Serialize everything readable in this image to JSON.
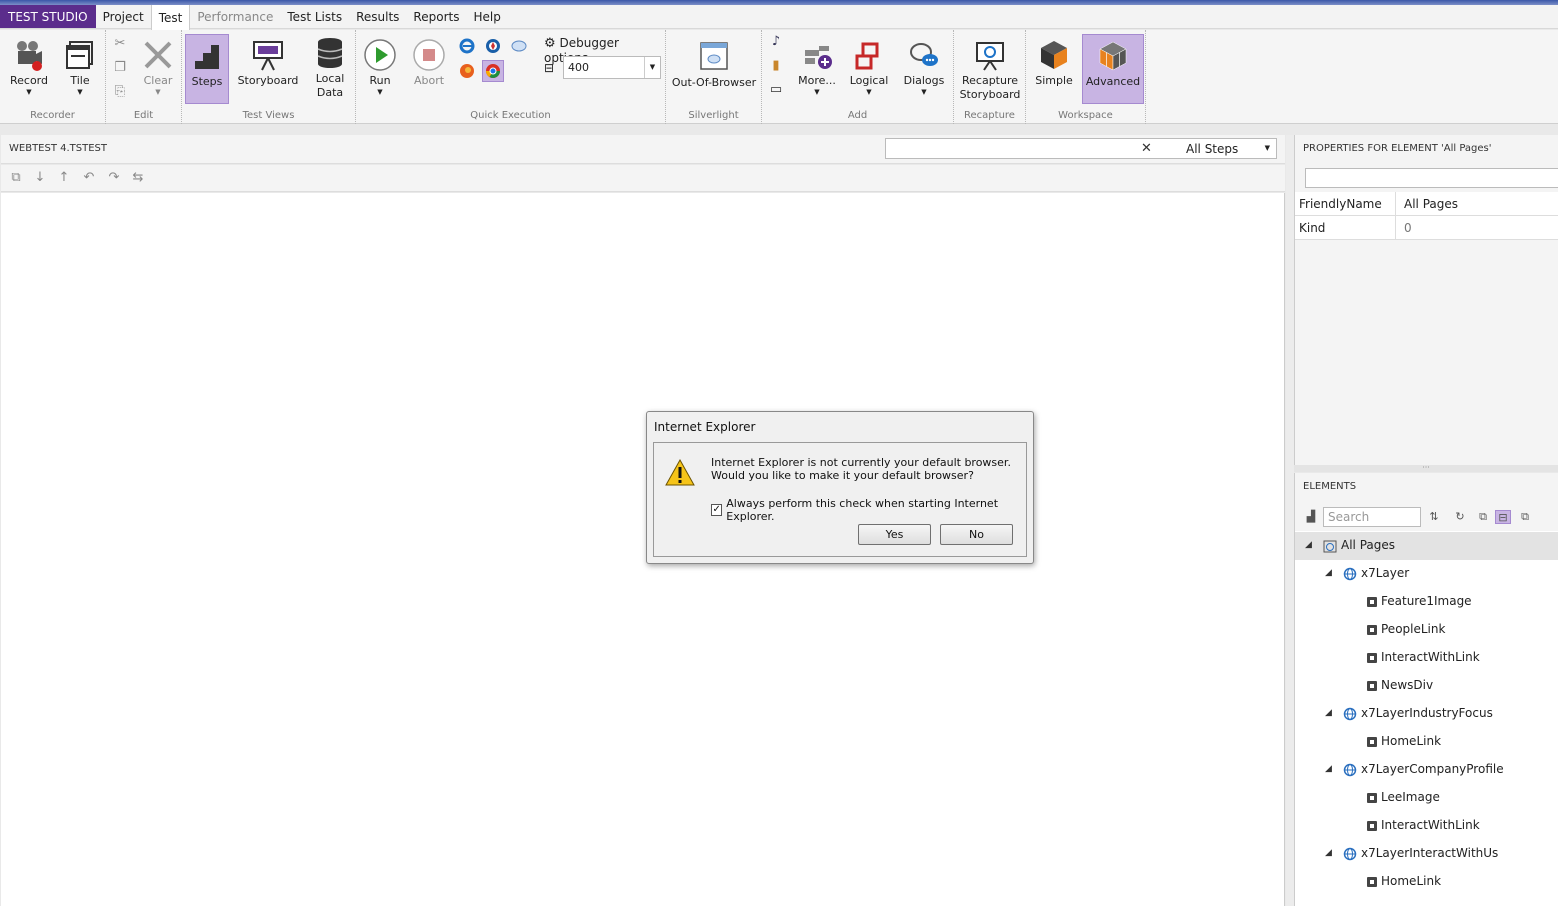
{
  "menubar": {
    "brand": "TEST STUDIO",
    "items": [
      {
        "label": "Project",
        "state": "normal"
      },
      {
        "label": "Test",
        "state": "active"
      },
      {
        "label": "Performance",
        "state": "disabled"
      },
      {
        "label": "Test Lists",
        "state": "normal"
      },
      {
        "label": "Results",
        "state": "normal"
      },
      {
        "label": "Reports",
        "state": "normal"
      },
      {
        "label": "Help",
        "state": "normal"
      }
    ]
  },
  "ribbon": {
    "groups": {
      "recorder": "Recorder",
      "edit": "Edit",
      "test_views": "Test Views",
      "quick_execution": "Quick Execution",
      "silverlight": "Silverlight",
      "add": "Add",
      "recapture": "Recapture",
      "workspace": "Workspace"
    },
    "buttons": {
      "record": "Record",
      "tile": "Tile",
      "clear": "Clear",
      "steps": "Steps",
      "storyboard": "Storyboard",
      "local_data_1": "Local",
      "local_data_2": "Data",
      "run": "Run",
      "abort": "Abort",
      "debugger_options": "Debugger options",
      "speed_value": "400",
      "out_of_browser": "Out-Of-Browser",
      "more": "More...",
      "logical": "Logical",
      "dialogs": "Dialogs",
      "recapture_1": "Recapture",
      "recapture_2": "Storyboard",
      "simple": "Simple",
      "advanced": "Advanced"
    }
  },
  "document": {
    "title": "WEBTEST 4.TSTEST",
    "filter_value": "All Steps"
  },
  "properties": {
    "title": "PROPERTIES FOR ELEMENT 'All Pages'",
    "rows": [
      {
        "name": "FriendlyName",
        "value": "All Pages"
      },
      {
        "name": "Kind",
        "value": "0"
      }
    ]
  },
  "elements": {
    "title": "ELEMENTS",
    "search_placeholder": "Search",
    "tree": [
      {
        "label": "All Pages",
        "level": 0,
        "type": "root"
      },
      {
        "label": "x7Layer",
        "level": 1,
        "type": "page"
      },
      {
        "label": "Feature1Image",
        "level": 2,
        "type": "leaf"
      },
      {
        "label": "PeopleLink",
        "level": 2,
        "type": "leaf"
      },
      {
        "label": "InteractWithLink",
        "level": 2,
        "type": "leaf"
      },
      {
        "label": "NewsDiv",
        "level": 2,
        "type": "leaf"
      },
      {
        "label": "x7LayerIndustryFocus",
        "level": 1,
        "type": "page"
      },
      {
        "label": "HomeLink",
        "level": 2,
        "type": "leaf"
      },
      {
        "label": "x7LayerCompanyProfile",
        "level": 1,
        "type": "page"
      },
      {
        "label": "LeeImage",
        "level": 2,
        "type": "leaf"
      },
      {
        "label": "InteractWithLink",
        "level": 2,
        "type": "leaf"
      },
      {
        "label": "x7LayerInteractWithUs",
        "level": 1,
        "type": "page"
      },
      {
        "label": "HomeLink",
        "level": 2,
        "type": "leaf"
      }
    ]
  },
  "dialog": {
    "title": "Internet Explorer",
    "message": "Internet Explorer is not currently your default browser. Would you like to make it your default browser?",
    "checkbox_label": "Always perform this check when starting Internet Explorer.",
    "checkbox_checked": true,
    "yes": "Yes",
    "no": "No"
  },
  "colors": {
    "brand": "#5b2d8c",
    "selected": "#c8b4e3"
  }
}
